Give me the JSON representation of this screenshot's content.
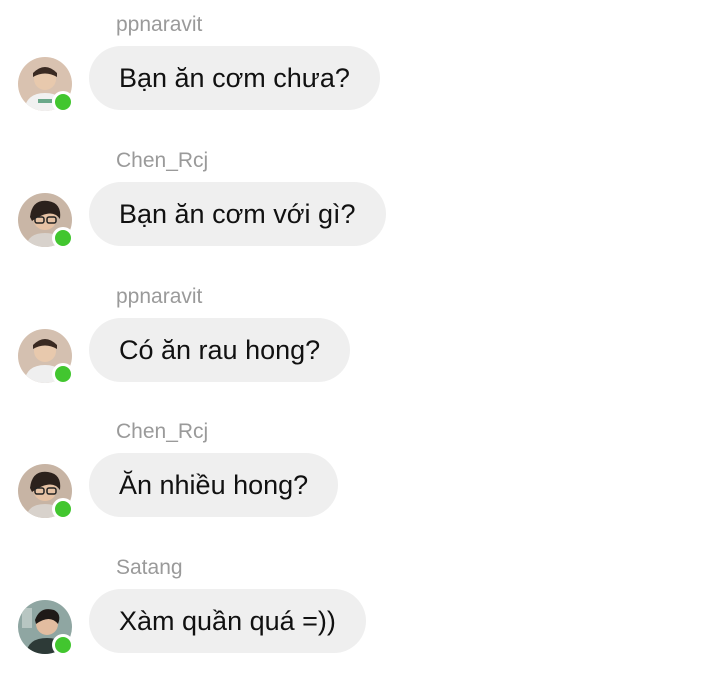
{
  "messages": [
    {
      "sender": "ppnaravit",
      "text": "Bạn ăn cơm chưa?"
    },
    {
      "sender": "Chen_Rcj",
      "text": "Bạn ăn cơm với gì?"
    },
    {
      "sender": "ppnaravit",
      "text": "Có ăn rau hong?"
    },
    {
      "sender": "Chen_Rcj",
      "text": "Ăn nhiều hong?"
    },
    {
      "sender": "Satang",
      "text": "Xàm quần quá =))"
    }
  ],
  "colors": {
    "bubble": "#efefef",
    "sender_name": "#9a9a9a",
    "message_text": "#111111",
    "online_dot": "#42c62f"
  },
  "icons": {
    "online_status": "online-status-dot",
    "avatar": "user-avatar"
  }
}
